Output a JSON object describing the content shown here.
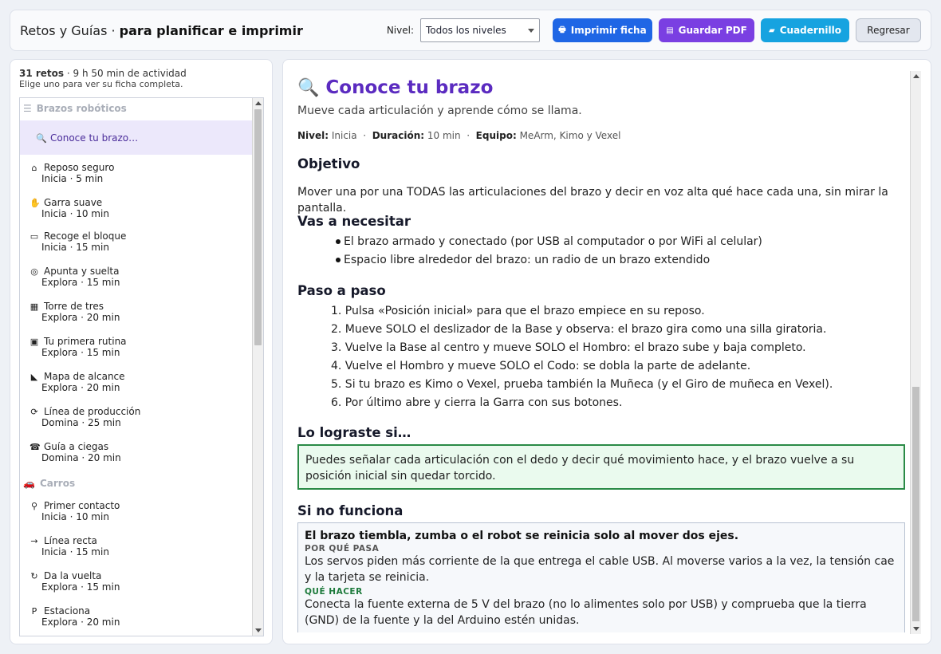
{
  "header": {
    "title_prefix": "Retos y Guías ·",
    "title_bold": "para planificar e imprimir",
    "level_label": "Nivel:",
    "level_value": "Todos los niveles",
    "btn_print": "Imprimir ficha",
    "btn_pdf": "Guardar PDF",
    "btn_notebook": "Cuadernillo",
    "btn_back": "Regresar",
    "colors": {
      "blue": "#1f66e5",
      "purple": "#7a3fe2",
      "cyan": "#16a3e0"
    }
  },
  "sidebar": {
    "count": "31 retos",
    "duration": "· 9 h 50 min de actividad",
    "hint": "Elige uno para ver su ficha completa.",
    "groups": [
      {
        "icon": "☰",
        "icon_name": "robot-arm-icon",
        "label": "Brazos robóticos"
      },
      {
        "icon": "🚗",
        "icon_name": "car-icon",
        "label": "Carros"
      }
    ],
    "selected": {
      "icon": "🔍",
      "label": "Conoce tu brazo…"
    },
    "items": [
      {
        "icon": "⌂",
        "icon_name": "home-icon",
        "label": "Reposo seguro",
        "sub": "Inicia · 5 min"
      },
      {
        "icon": "✋",
        "icon_name": "hand-icon",
        "label": "Garra suave",
        "sub": "Inicia · 10 min"
      },
      {
        "icon": "▭",
        "icon_name": "block-icon",
        "label": "Recoge el bloque",
        "sub": "Inicia · 15 min"
      },
      {
        "icon": "◎",
        "icon_name": "target-icon",
        "label": "Apunta y suelta",
        "sub": "Explora · 15 min"
      },
      {
        "icon": "▦",
        "icon_name": "tower-icon",
        "label": "Torre de tres",
        "sub": "Explora · 20 min"
      },
      {
        "icon": "▣",
        "icon_name": "floppy-icon",
        "label": "Tu primera rutina",
        "sub": "Explora · 15 min"
      },
      {
        "icon": "◣",
        "icon_name": "ruler-icon",
        "label": "Mapa de alcance",
        "sub": "Explora · 20 min"
      },
      {
        "icon": "⟳",
        "icon_name": "cycle-icon",
        "label": "Línea de producción",
        "sub": "Domina · 25 min"
      },
      {
        "icon": "☎",
        "icon_name": "blind-icon",
        "label": "Guía a ciegas",
        "sub": "Domina · 20 min"
      },
      {
        "icon": "⚲",
        "icon_name": "pin-icon",
        "label": "Primer contacto",
        "sub": "Inicia · 10 min"
      },
      {
        "icon": "→",
        "icon_name": "arrow-right-icon",
        "label": "Línea recta",
        "sub": "Inicia · 15 min"
      },
      {
        "icon": "↻",
        "icon_name": "rotate-icon",
        "label": "Da la vuelta",
        "sub": "Explora · 15 min"
      },
      {
        "icon": "P",
        "icon_name": "parking-icon",
        "label": "Estaciona",
        "sub": "Explora · 20 min"
      }
    ]
  },
  "detail": {
    "icon": "🔍",
    "title": "Conoce tu brazo",
    "subtitle": "Mueve cada articulación y aprende cómo se llama.",
    "meta": {
      "level_key": "Nivel:",
      "level_val": "Inicia",
      "duration_key": "Duración:",
      "duration_val": "10 min",
      "team_key": "Equipo:",
      "team_val": "MeArm, Kimo y Vexel"
    },
    "objective_title": "Objetivo",
    "objective": "Mover una por una TODAS las articulaciones del brazo y decir en voz alta qué hace cada una, sin mirar la pantalla.",
    "needs_title": "Vas a necesitar",
    "needs": [
      "El brazo armado y conectado (por USB al computador o por WiFi al celular)",
      "Espacio libre alrededor del brazo: un radio de un brazo extendido"
    ],
    "steps_title": "Paso a paso",
    "steps": [
      "1. Pulsa «Posición inicial» para que el brazo empiece en su reposo.",
      "2. Mueve SOLO el deslizador de la Base y observa: el brazo gira como una silla giratoria.",
      "3. Vuelve la Base al centro y mueve SOLO el Hombro: el brazo sube y baja completo.",
      "4. Vuelve el Hombro y mueve SOLO el Codo: se dobla la parte de adelante.",
      "5. Si tu brazo es Kimo o Vexel, prueba también la Muñeca (y el Giro de muñeca en Vexel).",
      "6. Por último abre y cierra la Garra con sus botones."
    ],
    "success_title": "Lo lograste si…",
    "success": "Puedes señalar cada articulación con el dedo y decir qué movimiento hace, y el brazo vuelve a su posición inicial sin quedar torcido.",
    "trouble_title": "Si no funciona",
    "trouble": {
      "question": "El brazo tiembla, zumba o el robot se reinicia solo al mover dos ejes.",
      "why_label": "POR QUÉ PASA",
      "why": "Los servos piden más corriente de la que entrega el cable USB. Al moverse varios a la vez, la tensión cae y la tarjeta se reinicia.",
      "fix_label": "QUÉ HACER",
      "fix": "Conecta la fuente externa de 5 V del brazo (no lo alimentes solo por USB) y comprueba que la tierra (GND) de la fuente y la del Arduino estén unidas."
    }
  }
}
